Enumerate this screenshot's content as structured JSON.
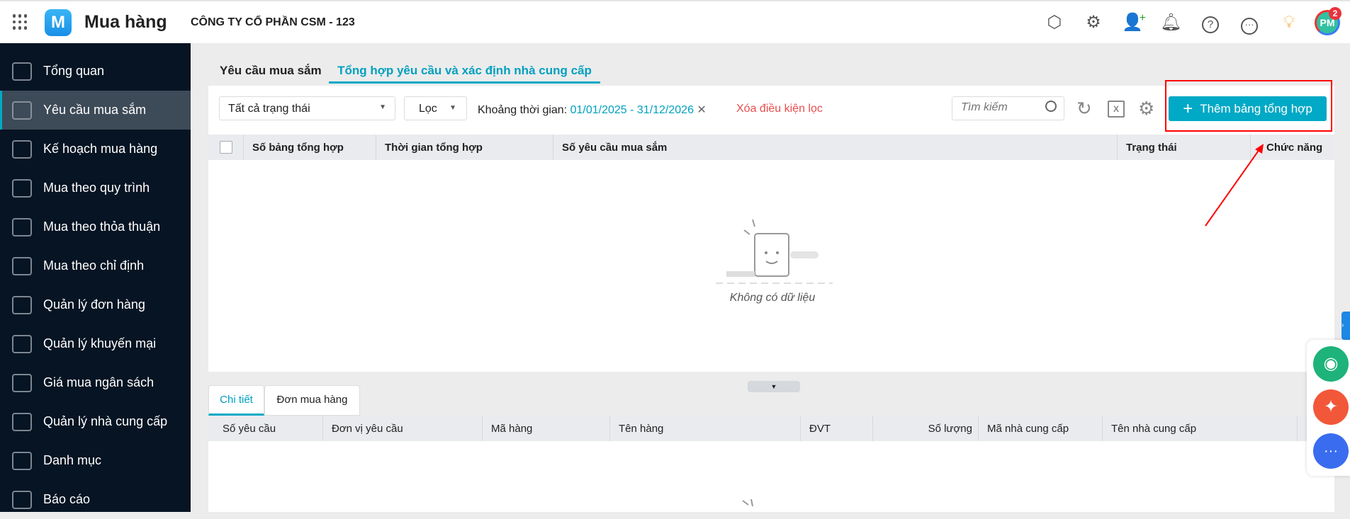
{
  "header": {
    "app_name": "Mua hàng",
    "company": "CÔNG TY CỔ PHẦN CSM - 123",
    "avatar_initials": "PM",
    "notification_count": "2",
    "icons": [
      "apps-grid-icon",
      "product-search-icon",
      "settings-icon",
      "add-user-icon",
      "bell-icon",
      "help-icon",
      "more-icon",
      "idea-book-icon"
    ]
  },
  "sidebar": {
    "items": [
      {
        "label": "Tổng quan",
        "icon": "dashboard-icon"
      },
      {
        "label": "Yêu cầu mua sắm",
        "icon": "clipboard-icon",
        "active": true
      },
      {
        "label": "Kế hoạch mua hàng",
        "icon": "plan-icon"
      },
      {
        "label": "Mua theo quy trình",
        "icon": "process-icon"
      },
      {
        "label": "Mua theo thỏa thuận",
        "icon": "scroll-icon"
      },
      {
        "label": "Mua theo chỉ định",
        "icon": "document-edit-icon"
      },
      {
        "label": "Quản lý đơn hàng",
        "icon": "order-box-icon"
      },
      {
        "label": "Quản lý khuyến mại",
        "icon": "discount-icon"
      },
      {
        "label": "Giá mua ngân sách",
        "icon": "budget-icon"
      },
      {
        "label": "Quản lý nhà cung cấp",
        "icon": "truck-icon"
      },
      {
        "label": "Danh mục",
        "icon": "category-icon"
      },
      {
        "label": "Báo cáo",
        "icon": "report-icon"
      }
    ]
  },
  "tabs": [
    {
      "label": "Yêu cầu mua sắm"
    },
    {
      "label": "Tổng hợp yêu cầu và xác định nhà cung cấp",
      "active": true
    }
  ],
  "toolbar": {
    "status_select": "Tất cả trạng thái",
    "filter_label": "Lọc",
    "period_label": "Khoảng thời gian:",
    "period_value": "01/01/2025 - 31/12/2026",
    "clear_filter": "Xóa điều kiện lọc",
    "search_placeholder": "Tìm kiếm",
    "add_button": "Thêm bảng tổng hợp"
  },
  "table": {
    "columns": [
      "Số bảng tổng hợp",
      "Thời gian tổng hợp",
      "Số yêu cầu mua sắm",
      "Trạng thái",
      "Chức năng"
    ],
    "empty_text": "Không có dữ liệu"
  },
  "detail": {
    "tabs": [
      {
        "label": "Chi tiết",
        "active": true
      },
      {
        "label": "Đơn mua hàng"
      }
    ],
    "columns": [
      "Số yêu cầu",
      "Đơn vị yêu cầu",
      "Mã hàng",
      "Tên hàng",
      "ĐVT",
      "Số lượng",
      "Mã nhà cung cấp",
      "Tên nhà cung cấp"
    ]
  },
  "colors": {
    "accent": "#00a9c5",
    "sidebar": "#061423",
    "danger": "#e84d4d",
    "highlight": "#ff0000"
  }
}
